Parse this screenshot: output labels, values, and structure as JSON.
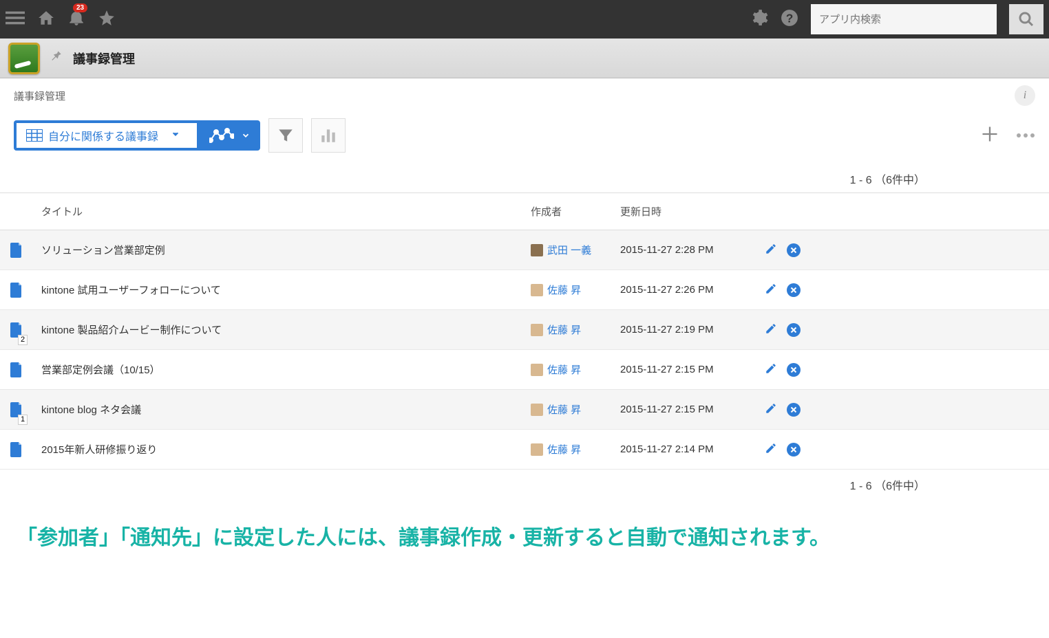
{
  "topbar": {
    "notification_count": "23",
    "search_placeholder": "アプリ内検索"
  },
  "app": {
    "title": "議事録管理",
    "breadcrumb": "議事録管理"
  },
  "toolbar": {
    "view_label": "自分に関係する議事録"
  },
  "pagination": {
    "top": "1 - 6 （6件中）",
    "bottom": "1 - 6 （6件中）"
  },
  "table": {
    "headers": {
      "title": "タイトル",
      "author": "作成者",
      "updated": "更新日時"
    },
    "rows": [
      {
        "badge": "",
        "title": "ソリューション営業部定例",
        "author": "武田 一義",
        "avatar": "avatar",
        "date": "2015-11-27 2:28 PM"
      },
      {
        "badge": "",
        "title": "kintone 試用ユーザーフォローについて",
        "author": "佐藤 昇",
        "avatar": "avatar2",
        "date": "2015-11-27 2:26 PM"
      },
      {
        "badge": "2",
        "title": "kintone 製品紹介ムービー制作について",
        "author": "佐藤 昇",
        "avatar": "avatar2",
        "date": "2015-11-27 2:19 PM"
      },
      {
        "badge": "",
        "title": "営業部定例会議（10/15）",
        "author": "佐藤 昇",
        "avatar": "avatar2",
        "date": "2015-11-27 2:15 PM"
      },
      {
        "badge": "1",
        "title": "kintone blog ネタ会議",
        "author": "佐藤 昇",
        "avatar": "avatar2",
        "date": "2015-11-27 2:15 PM"
      },
      {
        "badge": "",
        "title": "2015年新人研修振り返り",
        "author": "佐藤 昇",
        "avatar": "avatar2",
        "date": "2015-11-27 2:14 PM"
      }
    ]
  },
  "note": "「参加者」「通知先」に設定した人には、議事録作成・更新すると自動で通知されます。"
}
